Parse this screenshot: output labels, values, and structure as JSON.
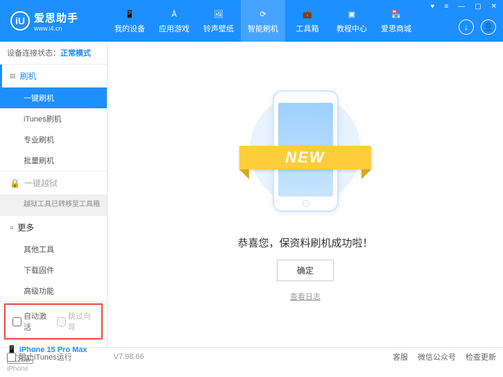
{
  "logo": {
    "short": "iU",
    "title": "爱思助手",
    "url": "www.i4.cn"
  },
  "nav": [
    {
      "label": "我的设备"
    },
    {
      "label": "应用游戏"
    },
    {
      "label": "铃声壁纸"
    },
    {
      "label": "智能刷机"
    },
    {
      "label": "工具箱"
    },
    {
      "label": "教程中心"
    },
    {
      "label": "爱思商城"
    }
  ],
  "conn": {
    "label": "设备连接状态：",
    "value": "正常模式"
  },
  "sidebar": {
    "flash": {
      "title": "刷机",
      "items": [
        "一键刷机",
        "iTunes刷机",
        "专业刷机",
        "批量刷机"
      ]
    },
    "jailbreak": {
      "title": "一键越狱",
      "note": "越狱工具已转移至工具箱"
    },
    "more": {
      "title": "更多",
      "items": [
        "其他工具",
        "下载固件",
        "高级功能"
      ]
    }
  },
  "opts": {
    "auto_activate": "自动激活",
    "skip_guide": "跳过向导"
  },
  "device": {
    "name": "iPhone 15 Pro Max",
    "storage": "512GB",
    "type": "iPhone"
  },
  "main": {
    "banner": "NEW",
    "success": "恭喜您，保资料刷机成功啦！",
    "ok": "确定",
    "view_log": "查看日志"
  },
  "footer": {
    "block_itunes": "阻止iTunes运行",
    "version": "V7.98.66",
    "links": [
      "客服",
      "微信公众号",
      "检查更新"
    ]
  }
}
